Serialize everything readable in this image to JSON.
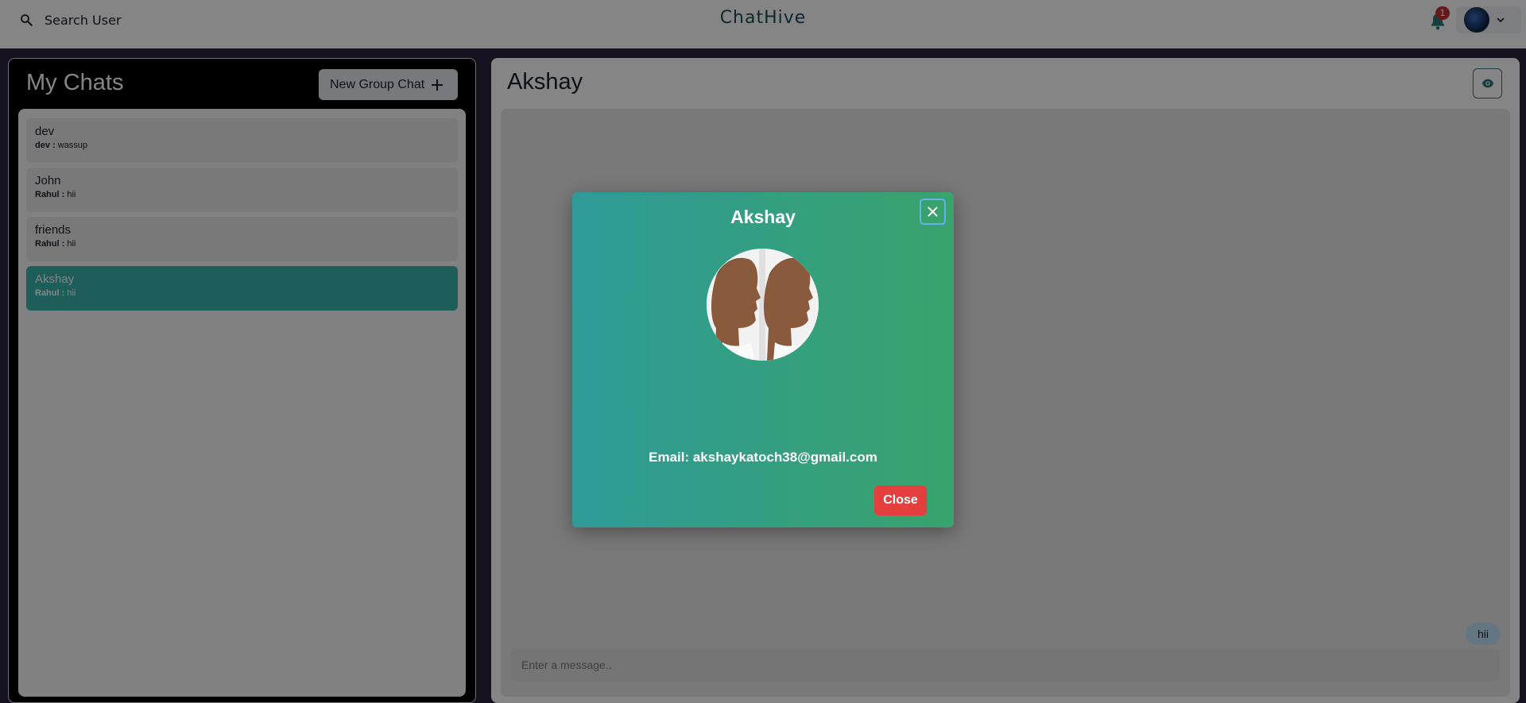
{
  "header": {
    "search_label": "Search User",
    "brand": "ChatHive",
    "notification_count": "1"
  },
  "chats_panel": {
    "title": "My Chats",
    "new_group_label": "New Group Chat",
    "items": [
      {
        "name": "dev",
        "sender": "dev :",
        "message": "wassup",
        "active": false
      },
      {
        "name": "John",
        "sender": "Rahul :",
        "message": "hii",
        "active": false
      },
      {
        "name": "friends",
        "sender": "Rahul :",
        "message": "hii",
        "active": false
      },
      {
        "name": "Akshay",
        "sender": "Rahul :",
        "message": "hii",
        "active": true
      }
    ]
  },
  "conversation": {
    "title": "Akshay",
    "messages": [
      {
        "text": "hii"
      }
    ],
    "input_placeholder": "Enter a message.."
  },
  "modal": {
    "title": "Akshay",
    "email_line": "Email: akshaykatoch38@gmail.com",
    "close_label": "Close"
  },
  "colors": {
    "accent": "#38b2ac",
    "danger": "#e53e3e",
    "modal_gradient_start": "#2f9a97",
    "modal_gradient_end": "#39a36c",
    "panel_bg": "#000000",
    "page_bg": "#2c1f3b",
    "bubble": "#bee3f8"
  },
  "icons": {
    "search": "search-icon",
    "bell": "bell-icon",
    "chevron": "chevron-down-icon",
    "plus": "plus-icon",
    "eye": "eye-icon",
    "close": "close-icon"
  }
}
